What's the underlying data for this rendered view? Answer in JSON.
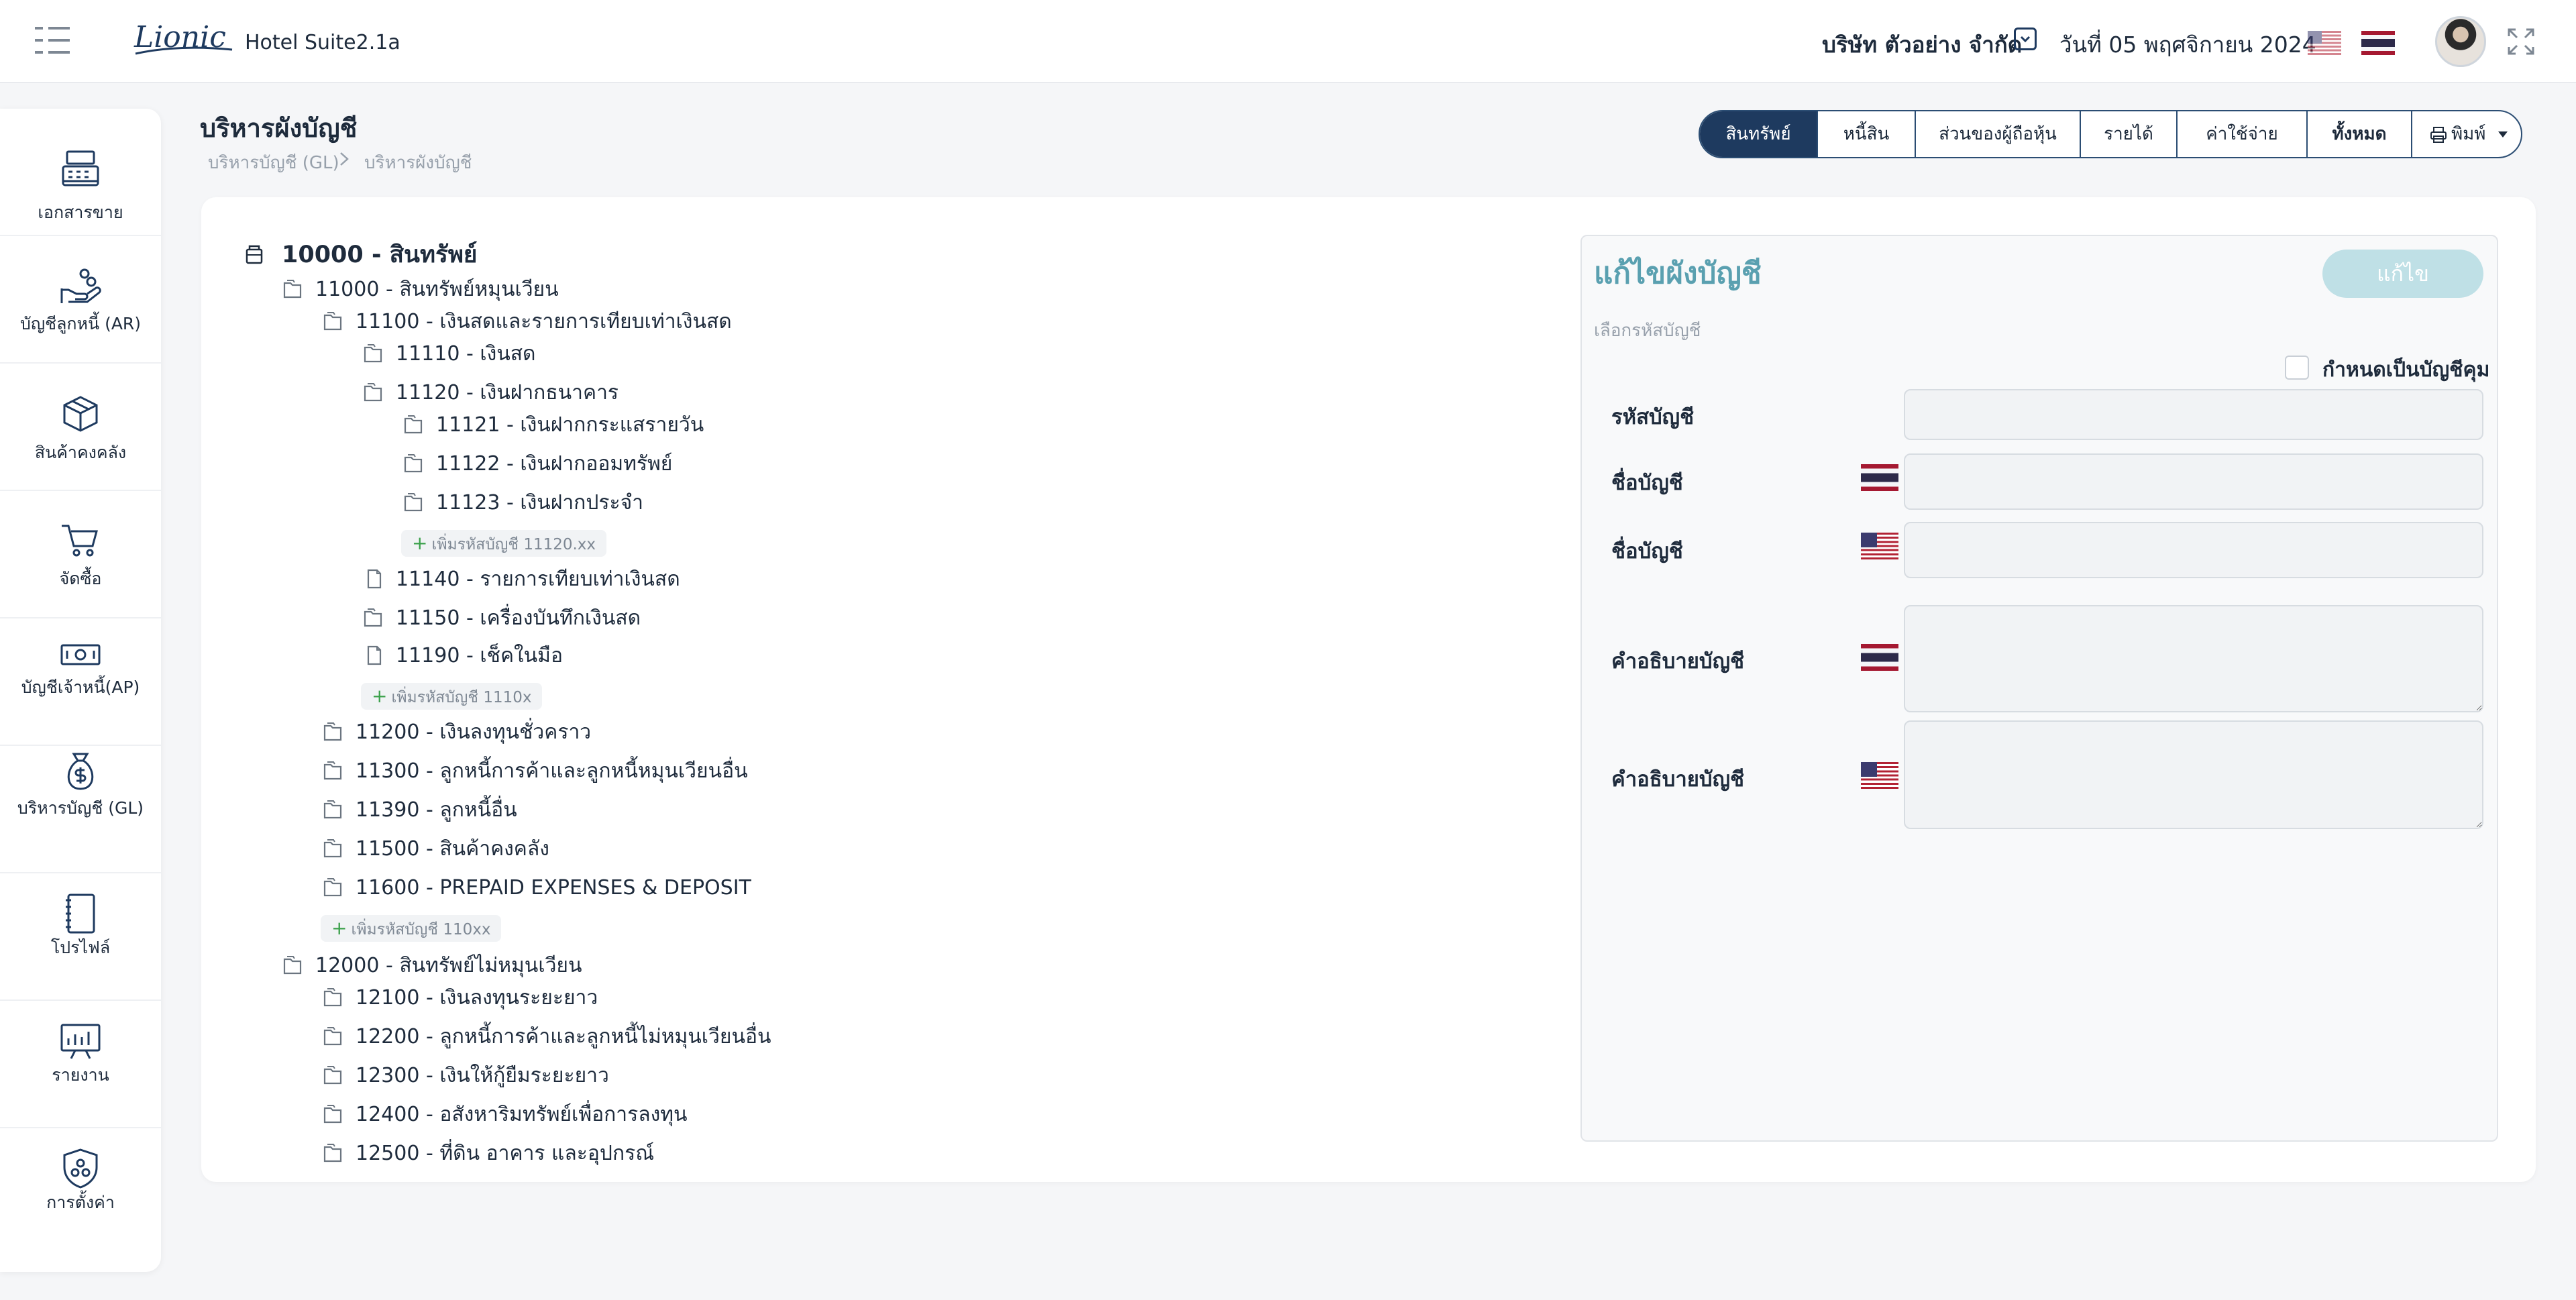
{
  "app": {
    "brand": "Lionic",
    "title": "Hotel Suite2.1a",
    "company": "บริษัท ตัวอย่าง จำกัด",
    "date": "วันที่ 05 พฤศจิกายน 2024",
    "colors": {
      "primary": "#1e3a5f",
      "accent": "#5aa0b0",
      "edit_button": "#bfe0e6"
    }
  },
  "sidebar": {
    "items": [
      {
        "label": "เอกสารขาย",
        "icon": "cash-register-icon"
      },
      {
        "label": "บัญชีลูกหนี้ (AR)",
        "icon": "hand-coins-icon"
      },
      {
        "label": "สินค้าคงคลัง",
        "icon": "box-icon"
      },
      {
        "label": "จัดซื้อ",
        "icon": "cart-icon"
      },
      {
        "label": "บัญชีเจ้าหนี้(AP)",
        "icon": "banknote-icon"
      },
      {
        "label": "บริหารบัญชี (GL)",
        "icon": "money-bag-icon"
      },
      {
        "label": "โปรไฟล์",
        "icon": "notebook-icon"
      },
      {
        "label": "รายงาน",
        "icon": "presentation-chart-icon"
      },
      {
        "label": "การตั้งค่า",
        "icon": "shield-gear-icon"
      }
    ]
  },
  "page": {
    "title": "บริหารผังบัญชี",
    "breadcrumb": [
      "บริหารบัญชี (GL)",
      "บริหารผังบัญชี"
    ]
  },
  "tabs": [
    {
      "label": "สินทรัพย์",
      "active": true
    },
    {
      "label": "หนี้สิน"
    },
    {
      "label": "ส่วนของผู้ถือหุ้น"
    },
    {
      "label": "รายได้"
    },
    {
      "label": "ค่าใช้จ่าย"
    },
    {
      "label": "ทั้งหมด"
    },
    {
      "label": "พิมพ์"
    }
  ],
  "tree": {
    "root": "10000 - สินทรัพย์",
    "n11000": "11000 - สินทรัพย์หมุนเวียน",
    "n11100": "11100 - เงินสดและรายการเทียบเท่าเงินสด",
    "n11110": "11110 - เงินสด",
    "n11120": "11120 - เงินฝากธนาคาร",
    "n11121": "11121 - เงินฝากกระแสรายวัน",
    "n11122": "11122 - เงินฝากออมทรัพย์",
    "n11123": "11123 - เงินฝากประจำ",
    "add_11120": "เพิ่มรหัสบัญชี 11120.xx",
    "n11140": "11140 - รายการเทียบเท่าเงินสด",
    "n11150": "11150 - เครื่องบันทึกเงินสด",
    "n11190": "11190 - เช็คในมือ",
    "add_1110x": "เพิ่มรหัสบัญชี 1110x",
    "n11200": "11200 - เงินลงทุนชั่วคราว",
    "n11300": "11300 - ลูกหนี้การค้าและลูกหนี้หมุนเวียนอื่น",
    "n11390": "11390 - ลูกหนี้อื่น",
    "n11500": "11500 - สินค้าคงคลัง",
    "n11600": "11600 - PREPAID EXPENSES & DEPOSIT",
    "add_110xx": "เพิ่มรหัสบัญชี 110xx",
    "n12000": "12000 - สินทรัพย์ไม่หมุนเวียน",
    "n12100": "12100 - เงินลงทุนระยะยาว",
    "n12200": "12200 - ลูกหนี้การค้าและลูกหนี้ไม่หมุนเวียนอื่น",
    "n12300": "12300 - เงินให้กู้ยืมระยะยาว",
    "n12400": "12400 - อสังหาริมทรัพย์เพื่อการลงทุน",
    "n12500": "12500 - ที่ดิน อาคาร และอุปกรณ์"
  },
  "edit_panel": {
    "title": "แก้ไขผังบัญชี",
    "edit_button": "แก้ไข",
    "select_hint": "เลือกรหัสบัญชี",
    "control_account_label": "กำหนดเป็นบัญชีคุม",
    "account_code_label": "รหัสบัญชี",
    "account_name_label_th": "ชื่อบัญชี",
    "account_name_label_en": "ชื่อบัญชี",
    "description_label_th": "คำอธิบายบัญชี",
    "description_label_en": "คำอธิบายบัญชี",
    "account_code_value": "",
    "account_name_th_value": "",
    "account_name_en_value": "",
    "description_th_value": "",
    "description_en_value": ""
  }
}
